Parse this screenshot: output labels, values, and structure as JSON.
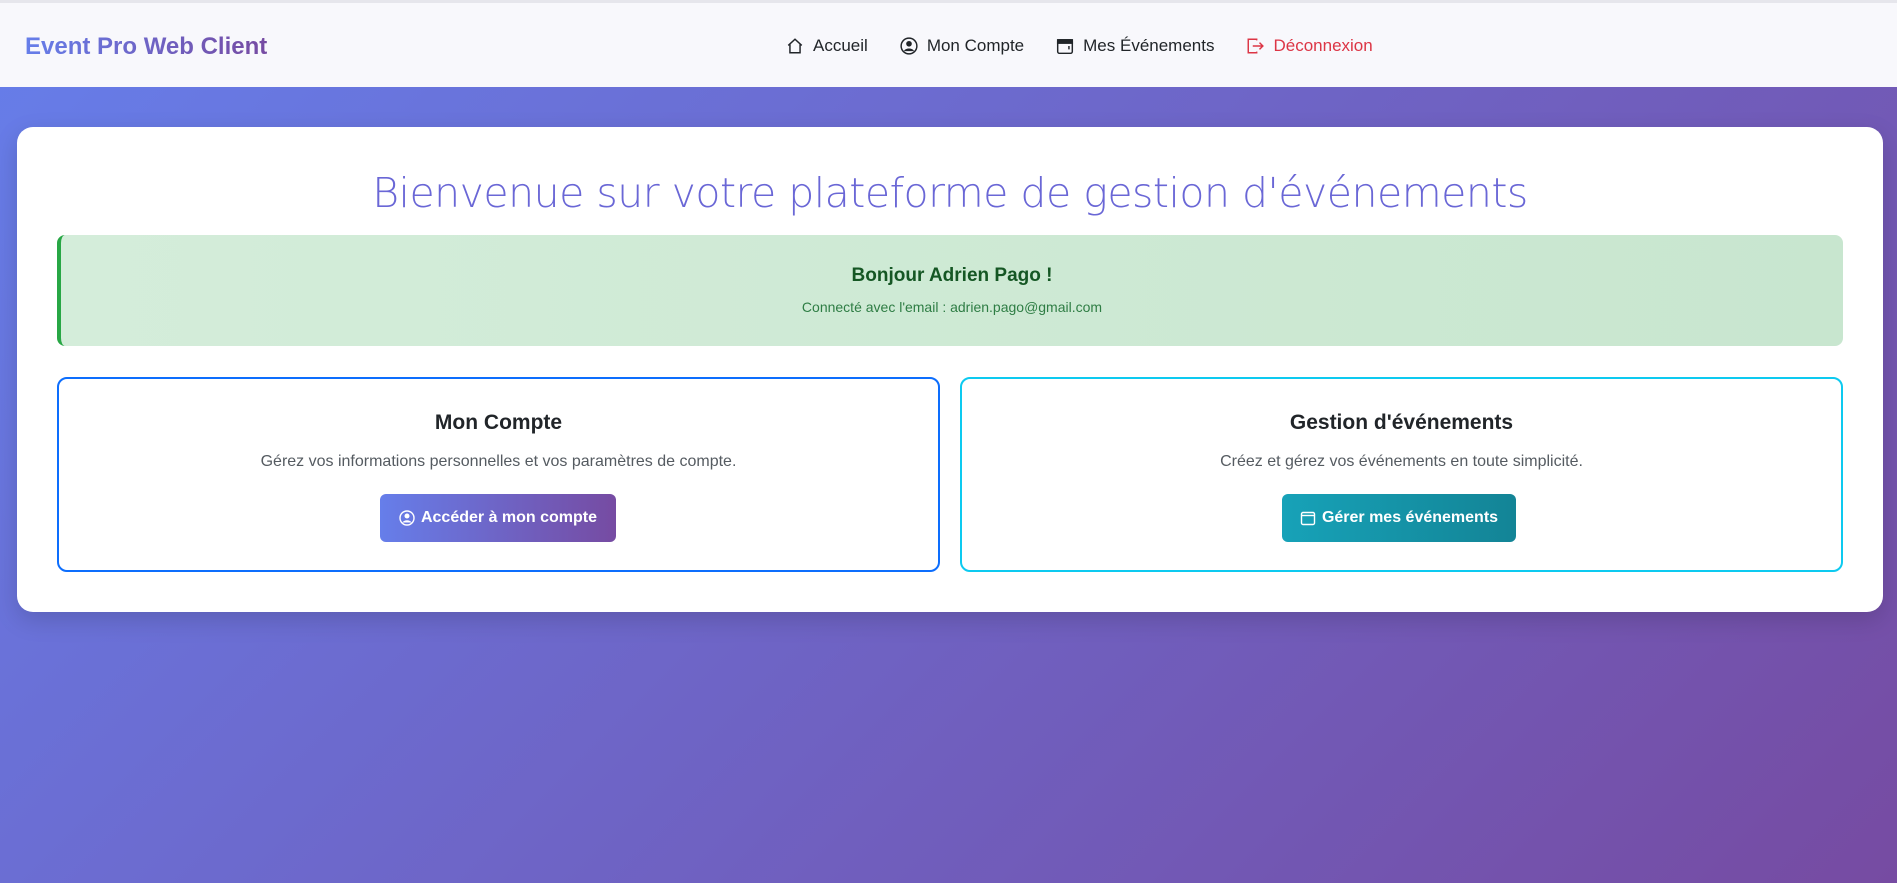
{
  "navbar": {
    "brand": "Event Pro Web Client",
    "items": [
      {
        "label": "Accueil",
        "icon": "house-icon"
      },
      {
        "label": "Mon Compte",
        "icon": "person-circle-icon"
      },
      {
        "label": "Mes Événements",
        "icon": "calendar-icon"
      },
      {
        "label": "Déconnexion",
        "icon": "logout-icon"
      }
    ]
  },
  "main": {
    "title": "Bienvenue sur votre plateforme de gestion d'événements",
    "alert": {
      "greeting": "Bonjour Adrien Pago !",
      "email_line": "Connecté avec l'email : adrien.pago@gmail.com"
    },
    "cards": [
      {
        "title": "Mon Compte",
        "description": "Gérez vos informations personnelles et vos paramètres de compte.",
        "button_label": "Accéder à mon compte",
        "button_icon": "person-circle-icon"
      },
      {
        "title": "Gestion d'événements",
        "description": "Créez et gérez vos événements en toute simplicité.",
        "button_label": "Gérer mes événements",
        "button_icon": "calendar-icon"
      }
    ]
  },
  "colors": {
    "gradient_start": "#667eea",
    "gradient_end": "#764ba2",
    "alert_border": "#28a745",
    "logout": "#dc3545",
    "account_border": "#0d6efd",
    "events_border": "#0dcaf0",
    "events_button": "#17a2b8"
  }
}
